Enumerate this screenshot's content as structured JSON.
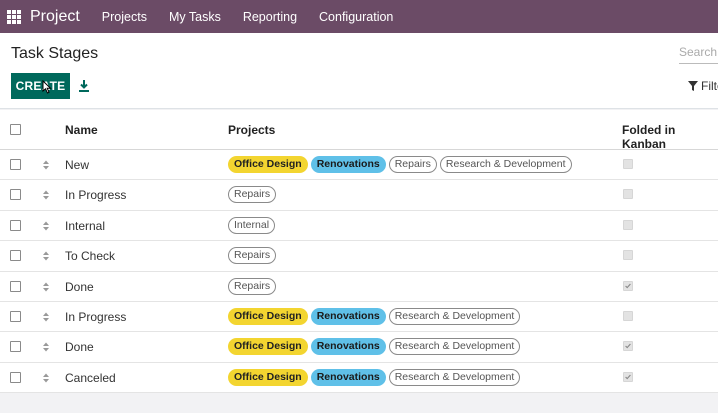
{
  "navbar": {
    "brand": "Project",
    "menu": [
      "Projects",
      "My Tasks",
      "Reporting",
      "Configuration"
    ],
    "apps_icon": "apps-grid-icon",
    "color": "#6b4b66"
  },
  "control_panel": {
    "title": "Task Stages",
    "search_placeholder": "Search...",
    "create_label": "CREATE",
    "download_icon": "download-icon",
    "filter_label": "Filters",
    "create_color": "#00695c"
  },
  "table": {
    "columns": [
      "Name",
      "Projects",
      "Folded in Kanban"
    ],
    "rows": [
      {
        "name": "New",
        "folded": false,
        "projects": [
          {
            "label": "Office Design",
            "style": "yellow"
          },
          {
            "label": "Renovations",
            "style": "blue"
          },
          {
            "label": "Repairs",
            "style": "outline"
          },
          {
            "label": "Research & Development",
            "style": "outline"
          }
        ]
      },
      {
        "name": "In Progress",
        "folded": false,
        "projects": [
          {
            "label": "Repairs",
            "style": "outline"
          }
        ]
      },
      {
        "name": "Internal",
        "folded": false,
        "projects": [
          {
            "label": "Internal",
            "style": "outline"
          }
        ]
      },
      {
        "name": "To Check",
        "folded": false,
        "projects": [
          {
            "label": "Repairs",
            "style": "outline"
          }
        ]
      },
      {
        "name": "Done",
        "folded": true,
        "projects": [
          {
            "label": "Repairs",
            "style": "outline"
          }
        ]
      },
      {
        "name": "In Progress",
        "folded": false,
        "projects": [
          {
            "label": "Office Design",
            "style": "yellow"
          },
          {
            "label": "Renovations",
            "style": "blue"
          },
          {
            "label": "Research & Development",
            "style": "outline"
          }
        ]
      },
      {
        "name": "Done",
        "folded": true,
        "projects": [
          {
            "label": "Office Design",
            "style": "yellow"
          },
          {
            "label": "Renovations",
            "style": "blue"
          },
          {
            "label": "Research & Development",
            "style": "outline"
          }
        ]
      },
      {
        "name": "Canceled",
        "folded": true,
        "projects": [
          {
            "label": "Office Design",
            "style": "yellow"
          },
          {
            "label": "Renovations",
            "style": "blue"
          },
          {
            "label": "Research & Development",
            "style": "outline"
          }
        ]
      }
    ]
  }
}
